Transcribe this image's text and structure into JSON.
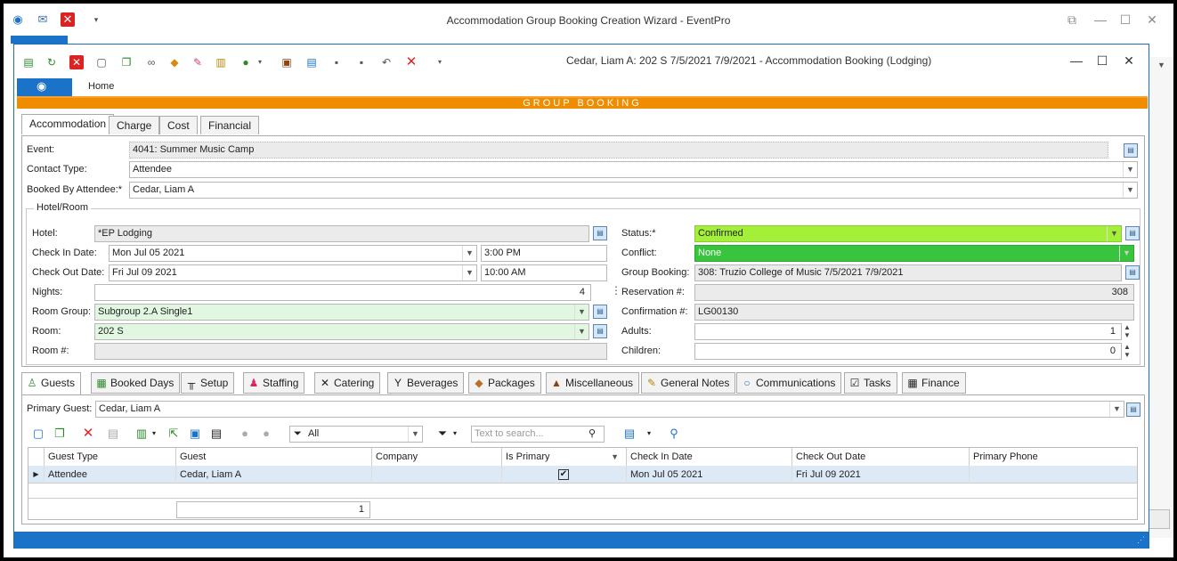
{
  "outer_window": {
    "title": "Accommodation Group Booking Creation Wizard - EventPro"
  },
  "inner_window": {
    "title": "Cedar, Liam A: 202 S 7/5/2021 7/9/2021  - Accommodation Booking (Lodging)"
  },
  "ribbon": {
    "home_tab": "Home"
  },
  "banner": "GROUP BOOKING",
  "tabs": [
    "Accommodation",
    "Charge",
    "Cost",
    "Financial"
  ],
  "form": {
    "event_label": "Event:",
    "event_value": "4041: Summer Music Camp",
    "contact_type_label": "Contact Type:",
    "contact_type_value": "Attendee",
    "booked_by_label": "Booked By Attendee:*",
    "booked_by_value": "Cedar, Liam A"
  },
  "hotel_room": {
    "group_title": "Hotel/Room",
    "hotel_label": "Hotel:",
    "hotel_value": "*EP Lodging",
    "checkin_label": "Check In Date:",
    "checkin_date": "Mon Jul 05 2021",
    "checkin_time": "3:00 PM",
    "checkout_label": "Check Out Date:",
    "checkout_date": "Fri Jul 09 2021",
    "checkout_time": "10:00 AM",
    "nights_label": "Nights:",
    "nights_value": "4",
    "room_group_label": "Room Group:",
    "room_group_value": "Subgroup 2.A Single1",
    "room_label": "Room:",
    "room_value": "202 S",
    "room_num_label": "Room #:",
    "room_num_value": "",
    "status_label": "Status:*",
    "status_value": "Confirmed",
    "conflict_label": "Conflict:",
    "conflict_value": "None",
    "group_booking_label": "Group Booking:",
    "group_booking_value": "308: Truzio College of Music 7/5/2021 7/9/2021",
    "reservation_label": "Reservation #:",
    "reservation_value": "308",
    "confirmation_label": "Confirmation #:",
    "confirmation_value": "LG00130",
    "adults_label": "Adults:",
    "adults_value": "1",
    "children_label": "Children:",
    "children_value": "0"
  },
  "bottom_tabs": [
    {
      "label": "Guests",
      "icon": "person-icon"
    },
    {
      "label": "Booked Days",
      "icon": "calendar-icon"
    },
    {
      "label": "Setup",
      "icon": "table-icon"
    },
    {
      "label": "Staffing",
      "icon": "staff-icon"
    },
    {
      "label": "Catering",
      "icon": "cutlery-icon"
    },
    {
      "label": "Beverages",
      "icon": "glass-icon"
    },
    {
      "label": "Packages",
      "icon": "package-icon"
    },
    {
      "label": "Miscellaneous",
      "icon": "misc-icon"
    },
    {
      "label": "General Notes",
      "icon": "notes-icon"
    },
    {
      "label": "Communications",
      "icon": "speech-icon"
    },
    {
      "label": "Tasks",
      "icon": "tasks-icon"
    },
    {
      "label": "Finance",
      "icon": "calculator-icon"
    }
  ],
  "guests": {
    "primary_guest_label": "Primary Guest:",
    "primary_guest_value": "Cedar, Liam A",
    "filter_value": "All",
    "search_placeholder": "Text to search...",
    "columns": [
      "Guest Type",
      "Guest",
      "Company",
      "Is Primary",
      "Check In Date",
      "Check Out Date",
      "Primary Phone"
    ],
    "rows": [
      {
        "guest_type": "Attendee",
        "guest": "Cedar, Liam A",
        "company": "",
        "is_primary": true,
        "check_in": "Mon Jul 05 2021",
        "check_out": "Fri Jul 09 2021",
        "phone": ""
      }
    ],
    "count": "1"
  },
  "colors": {
    "accent": "#1a73c8",
    "banner": "#f08c00",
    "status": "#a4ef38",
    "conflict": "#38c43c"
  }
}
